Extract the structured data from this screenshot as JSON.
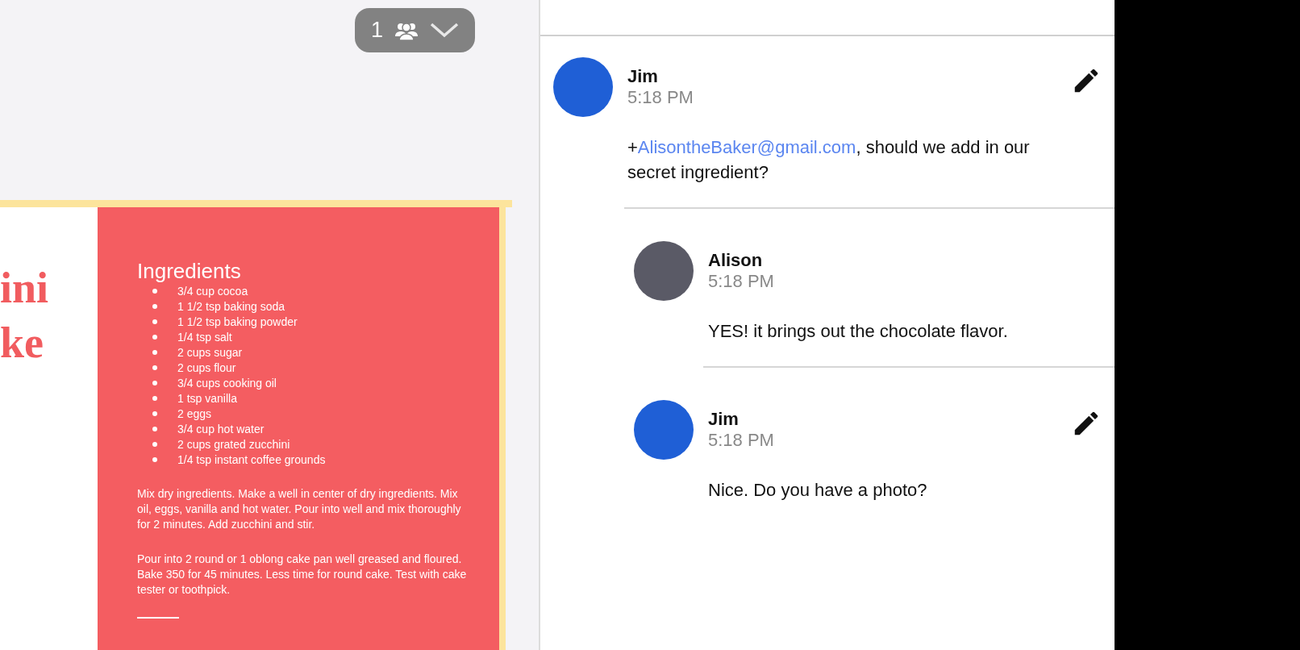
{
  "presence_pill": {
    "count": "1"
  },
  "document": {
    "title_lines": [
      "ini",
      "ke"
    ],
    "ingredients_heading": "Ingredients",
    "ingredients": [
      "3/4 cup cocoa",
      "1 1/2 tsp baking soda",
      "1 1/2 tsp baking powder",
      "1/4 tsp salt",
      "2 cups sugar",
      "2 cups flour",
      "3/4 cups cooking oil",
      "1 tsp vanilla",
      "2 eggs",
      "3/4 cup hot water",
      "2 cups grated zucchini",
      "1/4 tsp instant coffee grounds"
    ],
    "paragraphs": [
      "Mix dry ingredients. Make a well in center of dry ingredients. Mix oil, eggs, vanilla and hot water. Pour into well and mix thoroughly for 2 minutes. Add zucchini and stir.",
      "Pour into 2 round or 1 oblong cake pan well greased and floured. Bake 350 for 45 minutes.  Less time for round cake. Test with cake tester or toothpick."
    ]
  },
  "comments": [
    {
      "author": "Jim",
      "time": "5:18 PM",
      "editable": true,
      "color": "#1f5fd6",
      "parts": [
        {
          "kind": "text",
          "text": "+"
        },
        {
          "kind": "mention",
          "text": "AlisontheBaker@gmail.com"
        },
        {
          "kind": "text",
          "text": ", should we add in our secret ingredient?"
        }
      ]
    },
    {
      "author": "Alison",
      "time": "5:18 PM",
      "editable": false,
      "color": "#5a5a66",
      "parts": [
        {
          "kind": "text",
          "text": "YES! it brings out the chocolate flavor."
        }
      ]
    },
    {
      "author": "Jim",
      "time": "5:18 PM",
      "editable": true,
      "color": "#1f5fd6",
      "parts": [
        {
          "kind": "text",
          "text": "Nice. Do you have a photo?"
        }
      ]
    }
  ]
}
